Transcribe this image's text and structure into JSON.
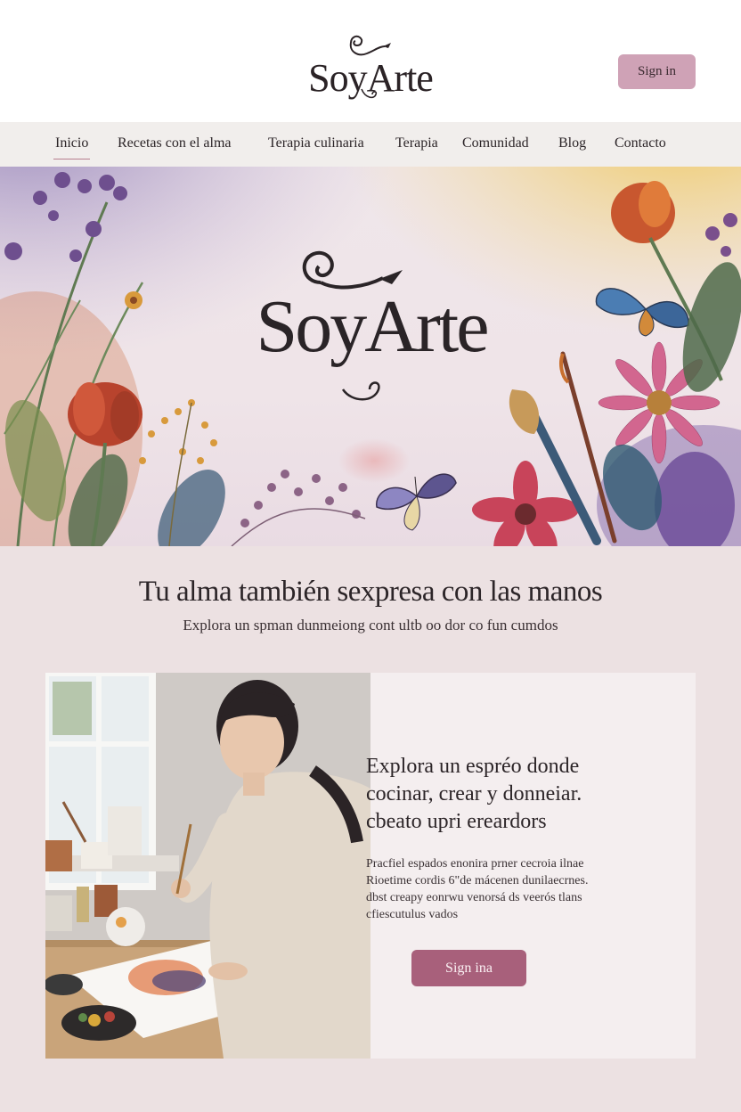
{
  "brand": {
    "name": "SoyArte"
  },
  "header": {
    "signin_label": "Sign in"
  },
  "nav": {
    "items": [
      {
        "label": "Inicio",
        "active": true
      },
      {
        "label": "Recetas con el alma",
        "active": false
      },
      {
        "label": "Terapia culinaria",
        "active": false
      },
      {
        "label": "Terapia",
        "active": false
      },
      {
        "label": "Comunidad",
        "active": false
      },
      {
        "label": "Blog",
        "active": false
      },
      {
        "label": "Contacto",
        "active": false
      }
    ]
  },
  "hero": {
    "title": "SoyArte",
    "illustration": "watercolor-flowers-butterflies-brushes"
  },
  "tagline": {
    "headline": "Tu alma también sexpresa con las manos",
    "subline": "Explora un spman dunmeiong cont ultb oo dor co fun cumdos"
  },
  "feature": {
    "image": "woman-painting-watercolor-at-kitchen-table",
    "heading_lines": [
      "Explora un espréo donde",
      "cocinar, crear y donneiar.",
      "cbeato upri ereardors"
    ],
    "body_lines": [
      "Pracfiel espados enonira prner cecroia ilnae",
      "Rioetime cordis 6\"de mácenen dunilaecrnes.",
      "dbst creapy eonrwu venorsá ds veerós tlans",
      "cfiescutulus vados"
    ],
    "button_label": "Sign ina"
  },
  "colors": {
    "accent": "#a8607b",
    "accent_light": "#cfa2b6",
    "background": "#ece1e2",
    "nav_bg": "#f1eeec"
  }
}
